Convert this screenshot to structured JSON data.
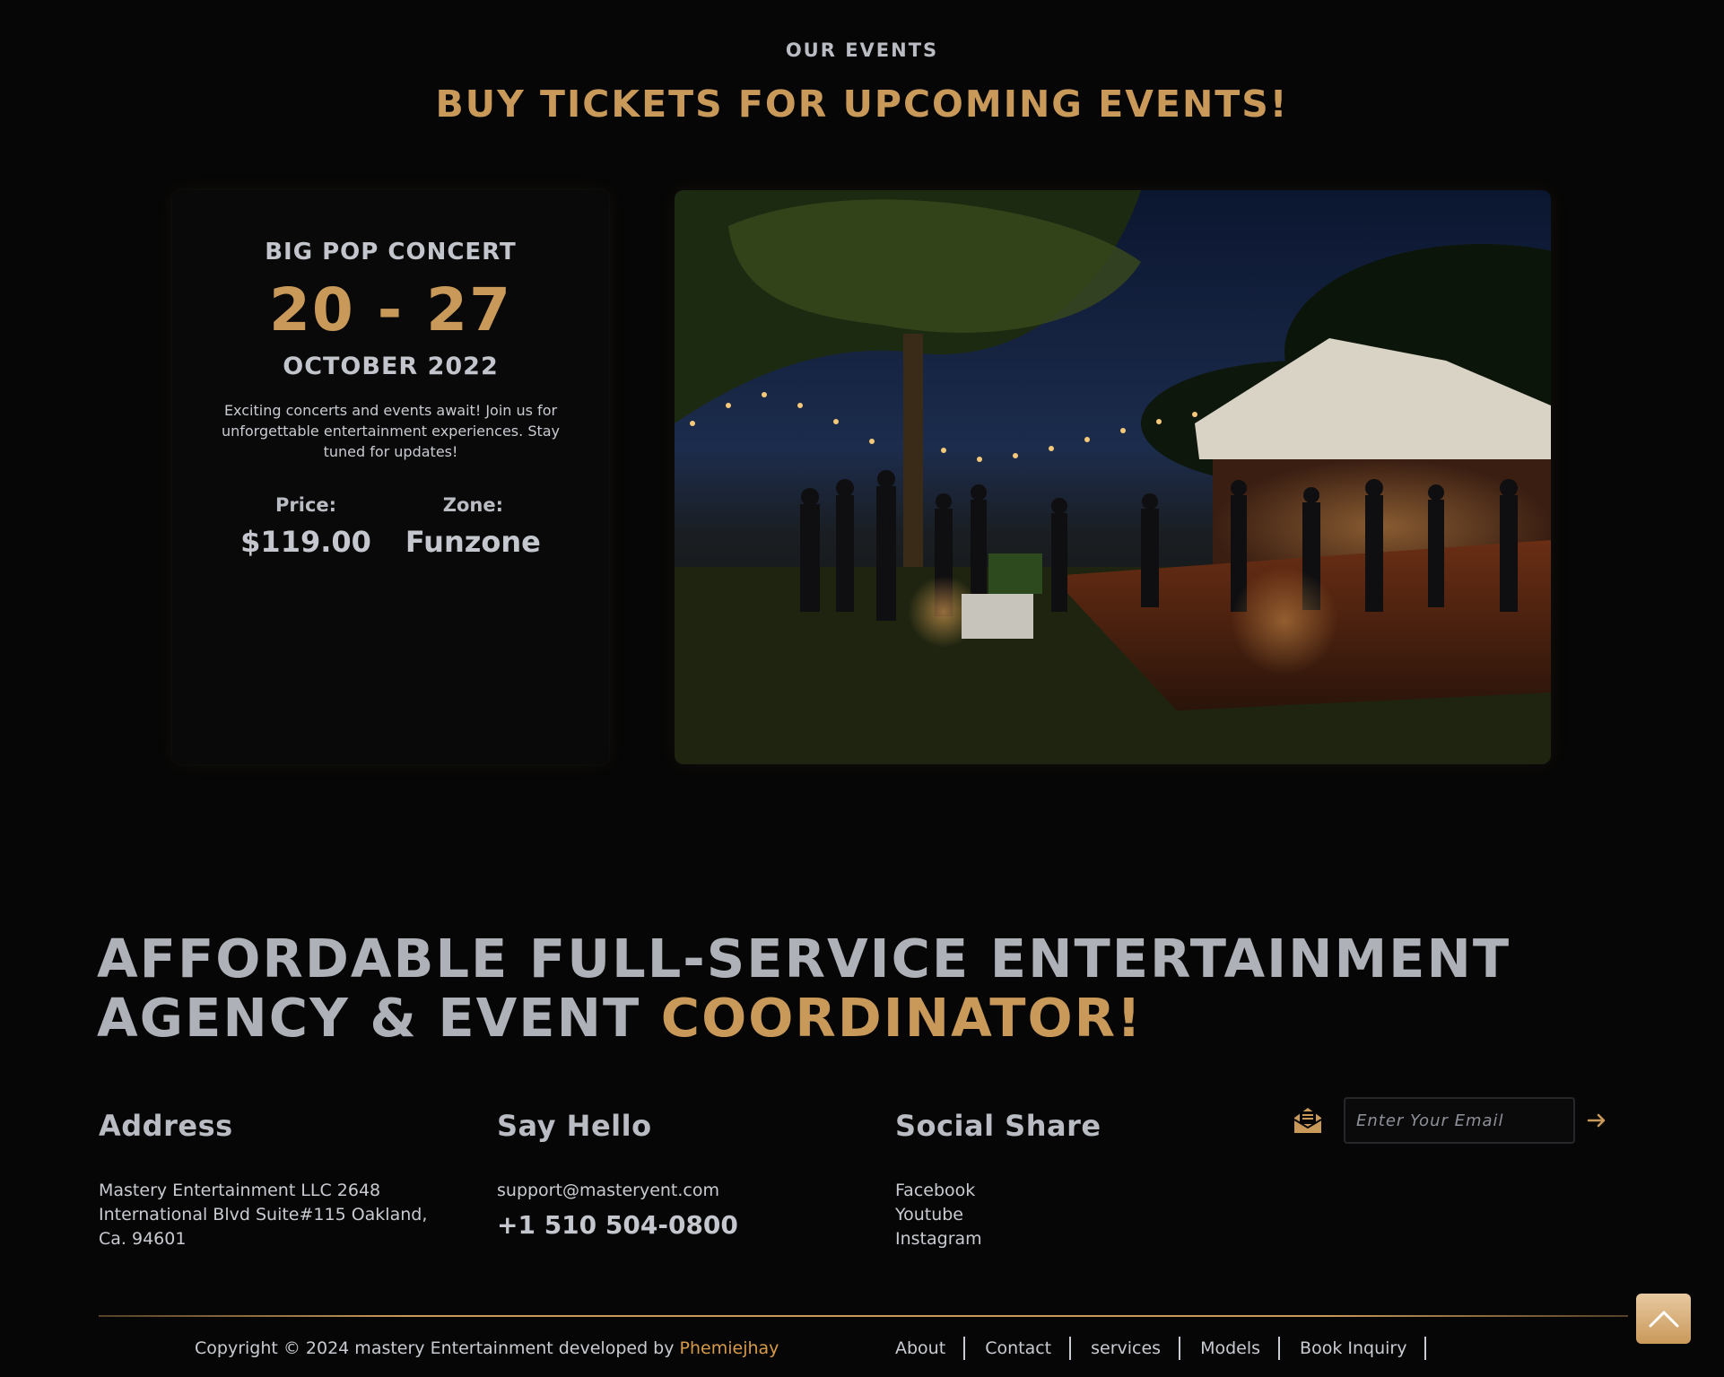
{
  "events_section": {
    "eyebrow": "OUR EVENTS",
    "title": "BUY TICKETS FOR UPCOMING EVENTS!"
  },
  "event": {
    "name": "BIG POP CONCERT",
    "dates": "20 - 27",
    "month": "OCTOBER 2022",
    "description": "Exciting concerts and events await! Join us for unforgettable entertainment experiences. Stay tuned for updates!",
    "price_label": "Price:",
    "price_value": "$119.00",
    "zone_label": "Zone:",
    "zone_value": "Funzone"
  },
  "tagline": {
    "line1": "AFFORDABLE FULL-SERVICE ENTERTAINMENT",
    "line2_plain": "AGENCY & EVENT ",
    "line2_accent": "COORDINATOR!"
  },
  "footer": {
    "address": {
      "heading": "Address",
      "text": "Mastery Entertainment LLC 2648 International Blvd Suite#115 Oakland, Ca. 94601"
    },
    "hello": {
      "heading": "Say Hello",
      "email": "support@masteryent.com",
      "phone": "+1 510 504-0800"
    },
    "social": {
      "heading": "Social Share",
      "links": [
        "Facebook",
        "Youtube",
        "Instagram"
      ]
    },
    "newsletter": {
      "placeholder": "Enter Your Email"
    },
    "copyright_prefix": "Copyright © 2024 mastery Entertainment developed by ",
    "developer": "Phemiejhay",
    "nav": [
      "About",
      "Contact",
      "services",
      "Models",
      "Book Inquiry"
    ]
  },
  "colors": {
    "accent": "#c9995a",
    "background": "#060606",
    "text": "#c8cbd1"
  },
  "icons": {
    "newsletter": "envelope-icon",
    "submit": "arrow-right-icon",
    "back_to_top": "chevron-up-icon"
  }
}
